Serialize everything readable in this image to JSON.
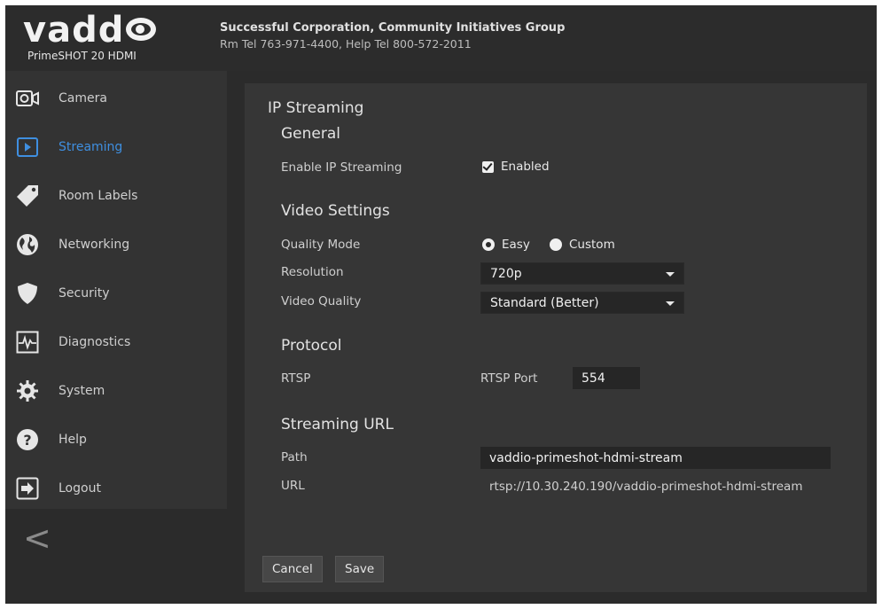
{
  "header": {
    "logo_text": "vadd",
    "model": "PrimeSHOT 20 HDMI",
    "organization": "Successful Corporation, Community Initiatives Group",
    "contact": "Rm Tel 763-971-4400, Help Tel 800-572-2011"
  },
  "sidebar": {
    "items": [
      {
        "label": "Camera",
        "icon": "camera-icon"
      },
      {
        "label": "Streaming",
        "icon": "play-icon",
        "active": true
      },
      {
        "label": "Room Labels",
        "icon": "tag-icon"
      },
      {
        "label": "Networking",
        "icon": "globe-icon"
      },
      {
        "label": "Security",
        "icon": "shield-icon"
      },
      {
        "label": "Diagnostics",
        "icon": "pulse-icon"
      },
      {
        "label": "System",
        "icon": "gear-icon"
      },
      {
        "label": "Help",
        "icon": "help-icon"
      },
      {
        "label": "Logout",
        "icon": "logout-icon"
      }
    ],
    "collapse_glyph": "<"
  },
  "main": {
    "page_title": "IP Streaming",
    "general": {
      "title": "General",
      "enable_label": "Enable IP Streaming",
      "enable_checked": true,
      "enable_value_label": "Enabled"
    },
    "video_settings": {
      "title": "Video Settings",
      "quality_mode_label": "Quality Mode",
      "quality_mode_options": [
        "Easy",
        "Custom"
      ],
      "quality_mode_selected": "Easy",
      "resolution_label": "Resolution",
      "resolution_value": "720p",
      "video_quality_label": "Video Quality",
      "video_quality_value": "Standard (Better)"
    },
    "protocol": {
      "title": "Protocol",
      "rtsp_label": "RTSP",
      "rtsp_port_label": "RTSP Port",
      "rtsp_port_value": "554"
    },
    "streaming_url": {
      "title": "Streaming URL",
      "path_label": "Path",
      "path_value": "vaddio-primeshot-hdmi-stream",
      "url_label": "URL",
      "url_value": "rtsp://10.30.240.190/vaddio-primeshot-hdmi-stream"
    },
    "buttons": {
      "cancel": "Cancel",
      "save": "Save"
    }
  },
  "colors": {
    "background": "#2b2b2b",
    "sidebar": "#333333",
    "panel": "#363636",
    "accent": "#3f8fe0"
  }
}
